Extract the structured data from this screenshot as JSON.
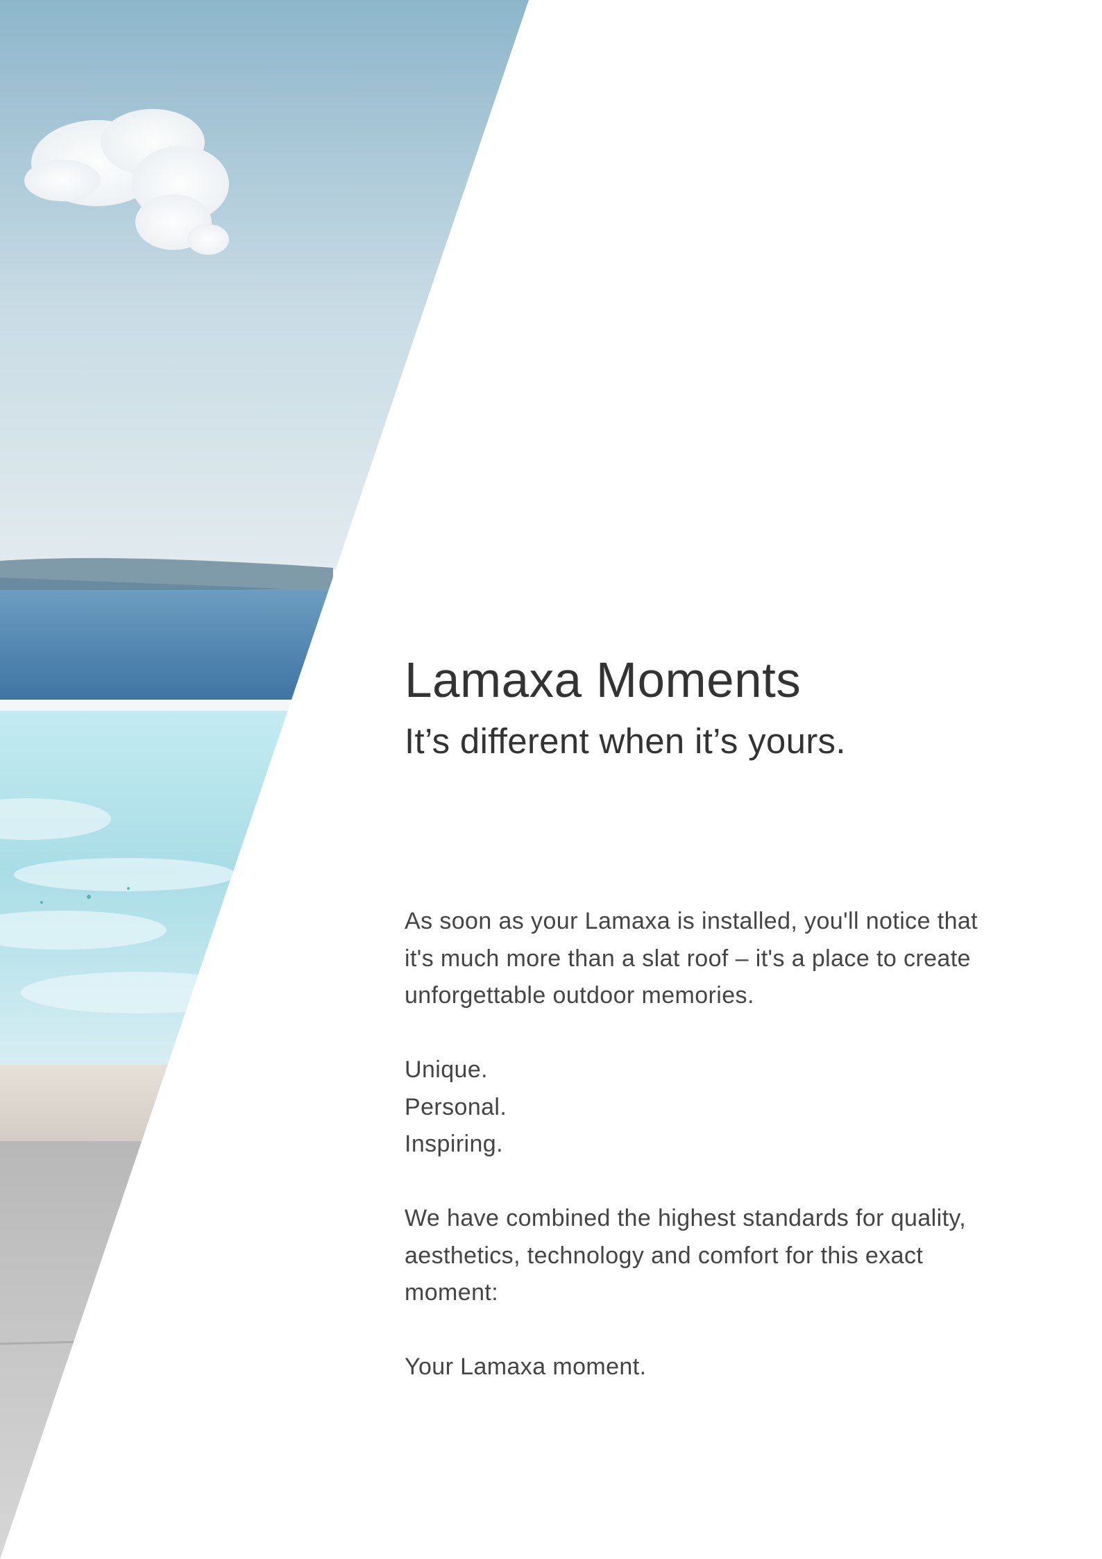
{
  "page": {
    "title": "Lamaxa Moments",
    "subtitle": "It’s different when it’s yours.",
    "intro_lines": [
      "As soon as your Lamaxa is installed, you'll notice that",
      "it's much more than a slat roof – it's a place to create",
      "unforgettable outdoor memories."
    ],
    "qualities": [
      "Unique.",
      "Personal.",
      "Inspiring."
    ],
    "combined_lines": [
      "We have combined the highest standards for quality,",
      "aesthetics, technology and comfort for this exact",
      "moment:"
    ],
    "closing": "Your Lamaxa moment."
  },
  "image": {
    "subject": "sea-and-infinity-pool-photo",
    "colors": {
      "sky_top": "#8fb8cc",
      "sky_bottom": "#dfe9ee",
      "sea": "#4f86b3",
      "pool": "#bfe6ef",
      "deck": "#dcd6cf",
      "paving": "#bdbdbd"
    }
  }
}
